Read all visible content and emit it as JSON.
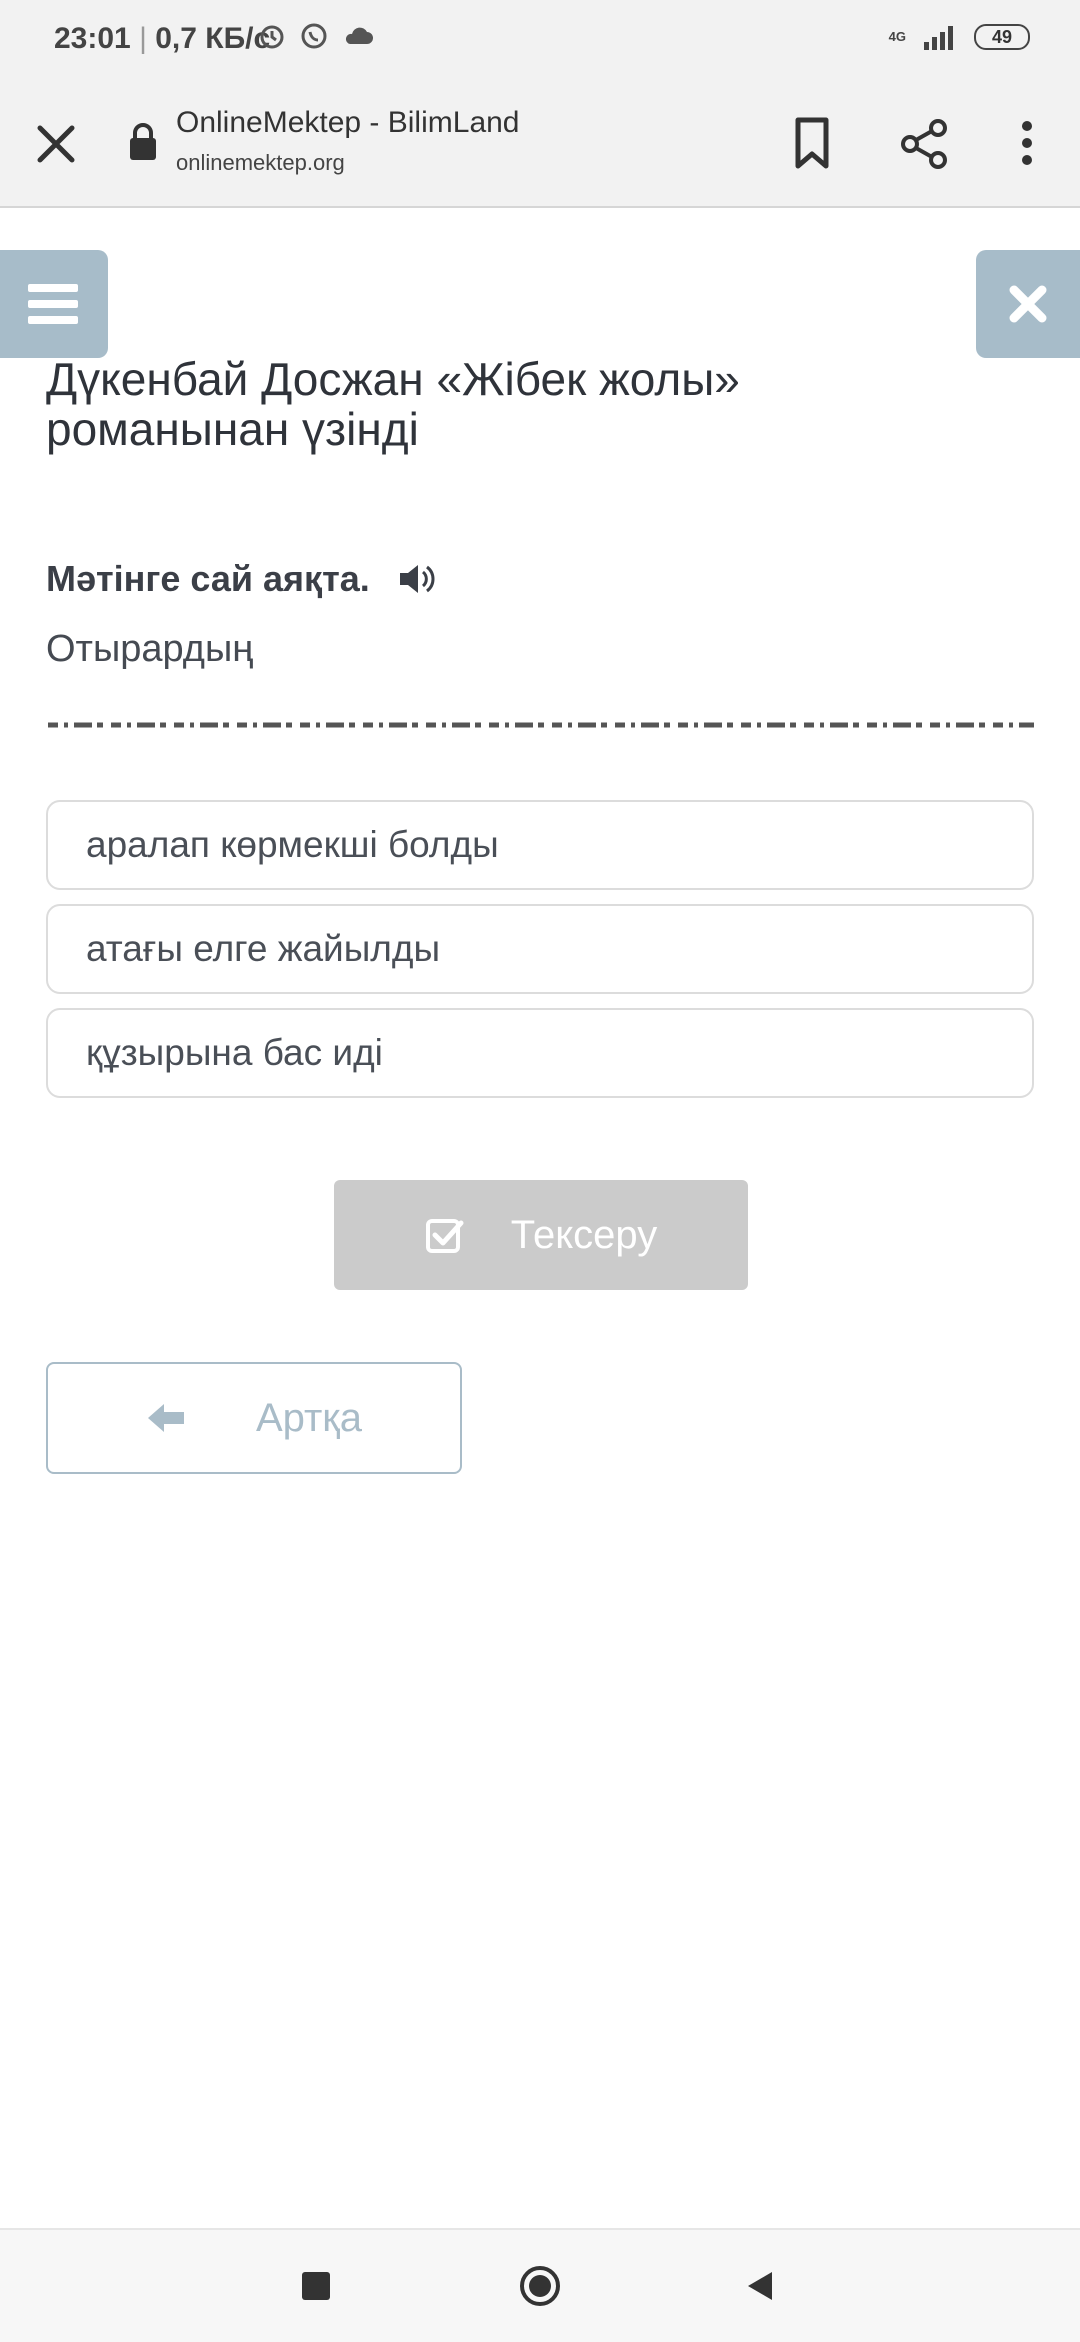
{
  "status_bar": {
    "time": "23:01",
    "separator": "|",
    "speed": "0,7 КБ/с",
    "network": "4G",
    "battery": "49",
    "icons": [
      "alarm-icon",
      "whatsapp-icon",
      "cloud-icon",
      "signal-icon"
    ]
  },
  "browser": {
    "title": "OnlineMektep - BilimLand",
    "url": "onlinemektep.org",
    "icons": [
      "close-icon",
      "lock-icon",
      "bookmark-icon",
      "share-icon",
      "more-icon"
    ]
  },
  "page": {
    "title": "Дүкенбай Досжан «Жібек жолы» романынан үзінді",
    "instruction": "Мәтінге сай аяқта.",
    "sentence": "Отырардың",
    "options": [
      "аралап көрмекші болды",
      "атағы елге жайылды",
      "құзырына бас иді"
    ],
    "check_button": "Тексеру",
    "back_button": "Артқа"
  },
  "colors": {
    "accent": "#a7bcc9",
    "disabled_button": "#cbcbcb",
    "text": "#3b3f47"
  }
}
